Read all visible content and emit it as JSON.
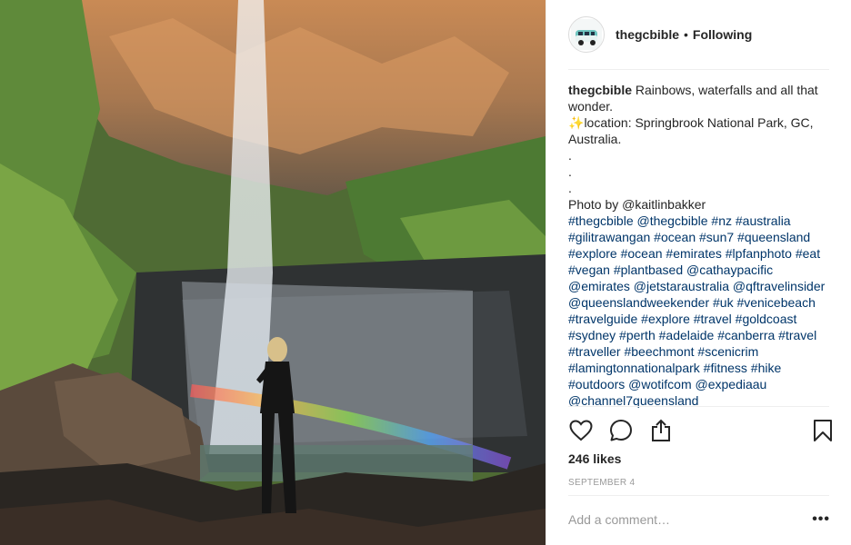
{
  "post": {
    "username": "thegcbible",
    "separator": "•",
    "follow_status": "Following"
  },
  "caption": {
    "username": "thegcbible",
    "text": " Rainbows, waterfalls and all that wonder.",
    "sparkle_emoji": "✨",
    "location_line": "location: Springbrook National Park, GC, Australia.",
    "dots": [
      ".",
      ".",
      "."
    ],
    "credit_line": "Photo by @kaitlinbakker",
    "hashtags": "#thegcbible @thegcbible #nz #australia #gilitrawangan #ocean #sun7 #queensland #explore #ocean #emirates #lpfanphoto #eat #vegan #plantbased @cathaypacific @emirates @jetstaraustralia @qftravelinsider @queenslandweekender #uk #venicebeach #travelguide #explore #travel #goldcoast #sydney #perth #adelaide #canberra #travel #traveller #beechmont #scenicrim #lamingtonnationalpark #fitness #hike #outdoors @wotifcom @expediaau @channel7queensland"
  },
  "actions": {
    "like_icon": "heart-icon",
    "comment_icon": "comment-icon",
    "share_icon": "share-icon",
    "save_icon": "bookmark-icon"
  },
  "likes_text": "246 likes",
  "date_text": "SEPTEMBER 4",
  "comment_box": {
    "placeholder": "Add a comment…",
    "more_label": "•••"
  },
  "photo": {
    "description_icon": "waterfall-photo"
  }
}
